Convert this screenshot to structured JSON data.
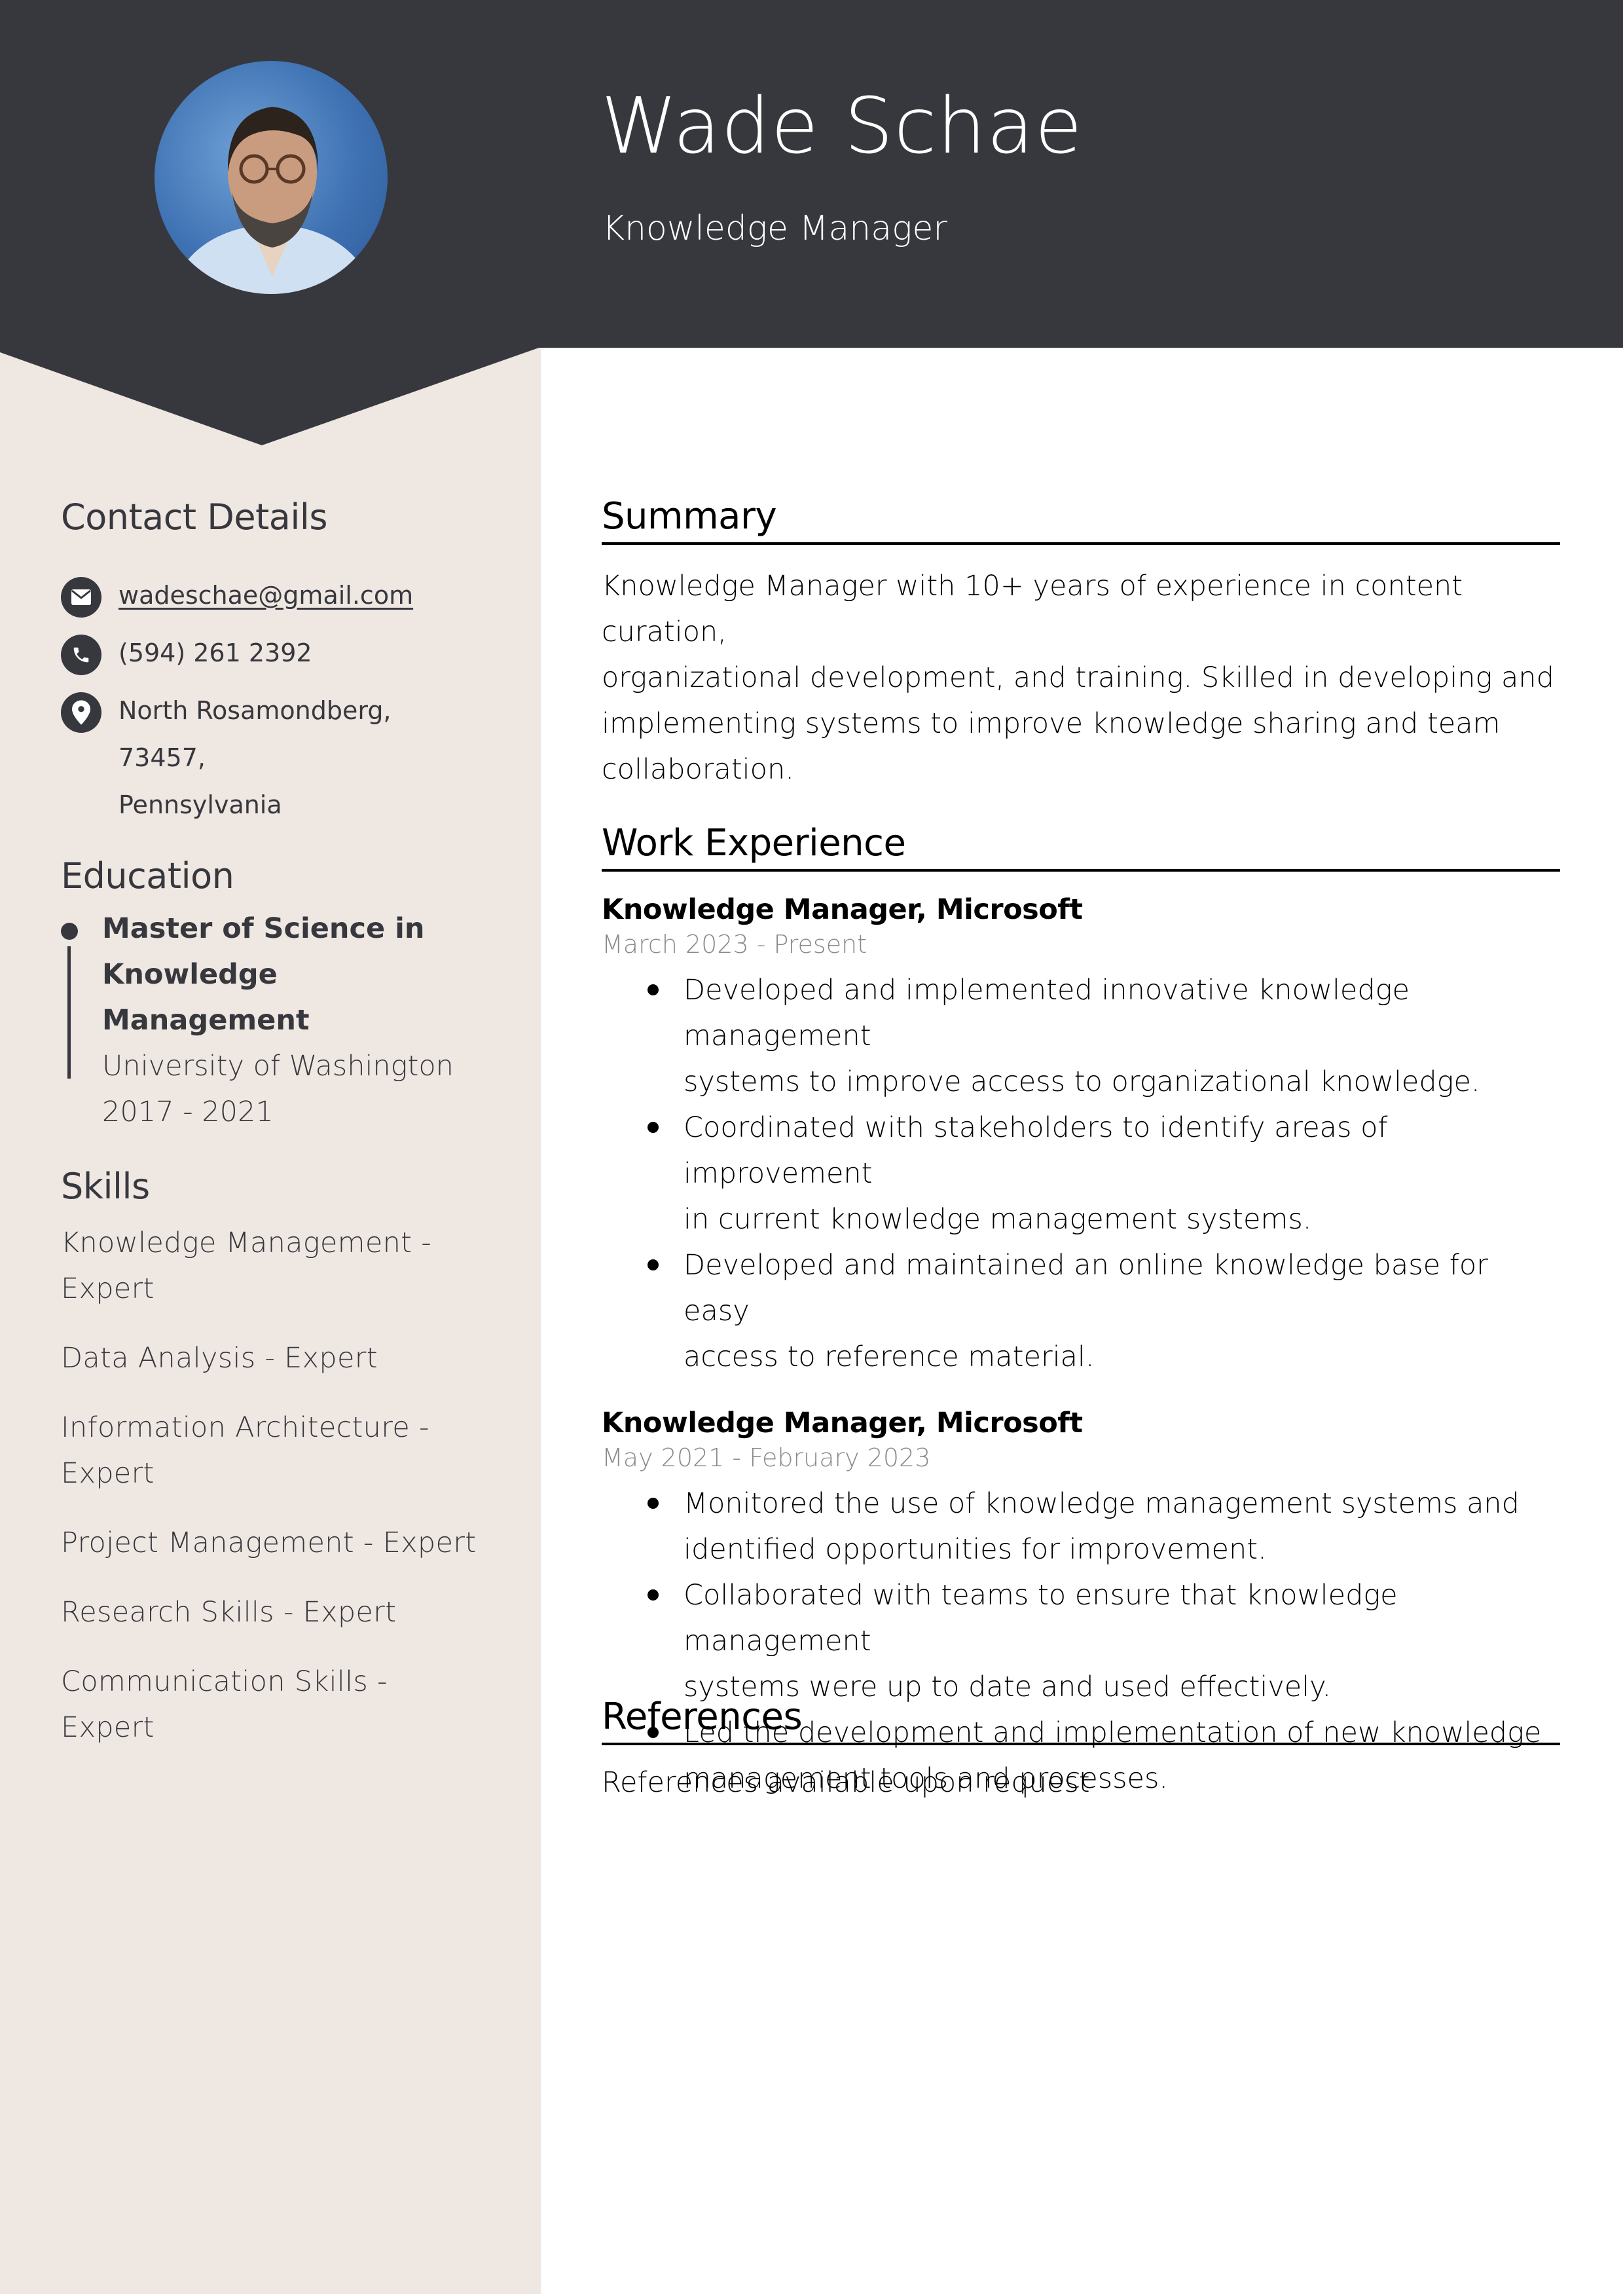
{
  "header": {
    "name": "Wade Schae",
    "title": "Knowledge Manager",
    "photo_alt": "profile-photo"
  },
  "colors": {
    "header_bg": "#37383e",
    "sidebar_bg": "#efe7e2",
    "text_dark": "#37383e",
    "date_gray": "#8b8b8b"
  },
  "sidebar": {
    "contact": {
      "heading": "Contact Details",
      "items": [
        {
          "icon": "envelope-icon",
          "text": "wadeschae@gmail.com"
        },
        {
          "icon": "phone-icon",
          "text": "(594) 261 2392"
        },
        {
          "icon": "location-pin-icon",
          "line1": "North Rosamondberg, 73457,",
          "line2": "Pennsylvania"
        }
      ]
    },
    "education": {
      "heading": "Education",
      "degree_line1": "Master of Science in",
      "degree_line2": "Knowledge Management",
      "school": "University of Washington",
      "years": "2017 - 2021"
    },
    "skills": {
      "heading": "Skills",
      "items": [
        {
          "line1": "Knowledge Management -",
          "line2": "Expert"
        },
        {
          "line1": "Data Analysis - Expert"
        },
        {
          "line1": "Information Architecture -",
          "line2": "Expert"
        },
        {
          "line1": "Project Management - Expert"
        },
        {
          "line1": "Research Skills - Expert"
        },
        {
          "line1": "Communication Skills - Expert"
        }
      ]
    }
  },
  "main": {
    "summary": {
      "heading": "Summary",
      "lines": [
        "Knowledge Manager with 10+ years of experience in content curation,",
        "organizational development, and training. Skilled in developing and",
        "implementing systems to improve knowledge sharing and team",
        "collaboration."
      ]
    },
    "experience": {
      "heading": "Work Experience",
      "jobs": [
        {
          "title": "Knowledge Manager, Microsoft",
          "dates": "March 2023 - Present",
          "bullets": [
            [
              "Developed and implemented innovative knowledge management",
              "systems to improve access to organizational knowledge."
            ],
            [
              "Coordinated with stakeholders to identify areas of improvement",
              "in current knowledge management systems."
            ],
            [
              "Developed and maintained an online knowledge base for easy",
              "access to reference material."
            ]
          ]
        },
        {
          "title": "Knowledge Manager, Microsoft",
          "dates": "May 2021 - February 2023",
          "bullets": [
            [
              "Monitored the use of knowledge management systems and",
              "identified opportunities for improvement."
            ],
            [
              "Collaborated with teams to ensure that knowledge management",
              "systems were up to date and used effectively."
            ],
            [
              "Led the development and implementation of new knowledge",
              "management tools and processes."
            ]
          ]
        }
      ]
    },
    "references": {
      "heading": "References",
      "text": "References available upon request"
    }
  }
}
